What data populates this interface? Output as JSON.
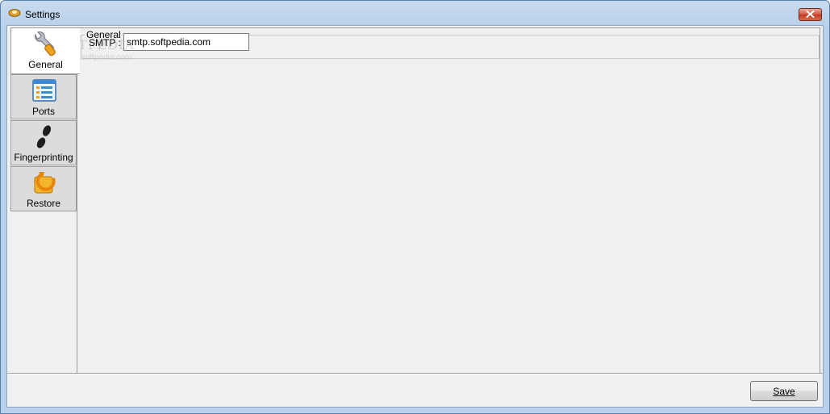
{
  "window": {
    "title": "Settings",
    "accent": "#b9d1ea",
    "close_color": "#c13b22"
  },
  "tabs": [
    {
      "label": "General",
      "icon": "wrench-icon",
      "active": true
    },
    {
      "label": "Ports",
      "icon": "list-window-icon",
      "active": false
    },
    {
      "label": "Fingerprinting",
      "icon": "footprints-icon",
      "active": false
    },
    {
      "label": "Restore",
      "icon": "restore-arrow-icon",
      "active": false
    }
  ],
  "general": {
    "group_title": "General",
    "smtp_label": "SMTP :",
    "smtp_value": "smtp.softpedia.com"
  },
  "footer": {
    "save_label": "Save"
  },
  "watermark": {
    "brand": "SOFTPEDIA",
    "url": "www.softpedia.com"
  }
}
